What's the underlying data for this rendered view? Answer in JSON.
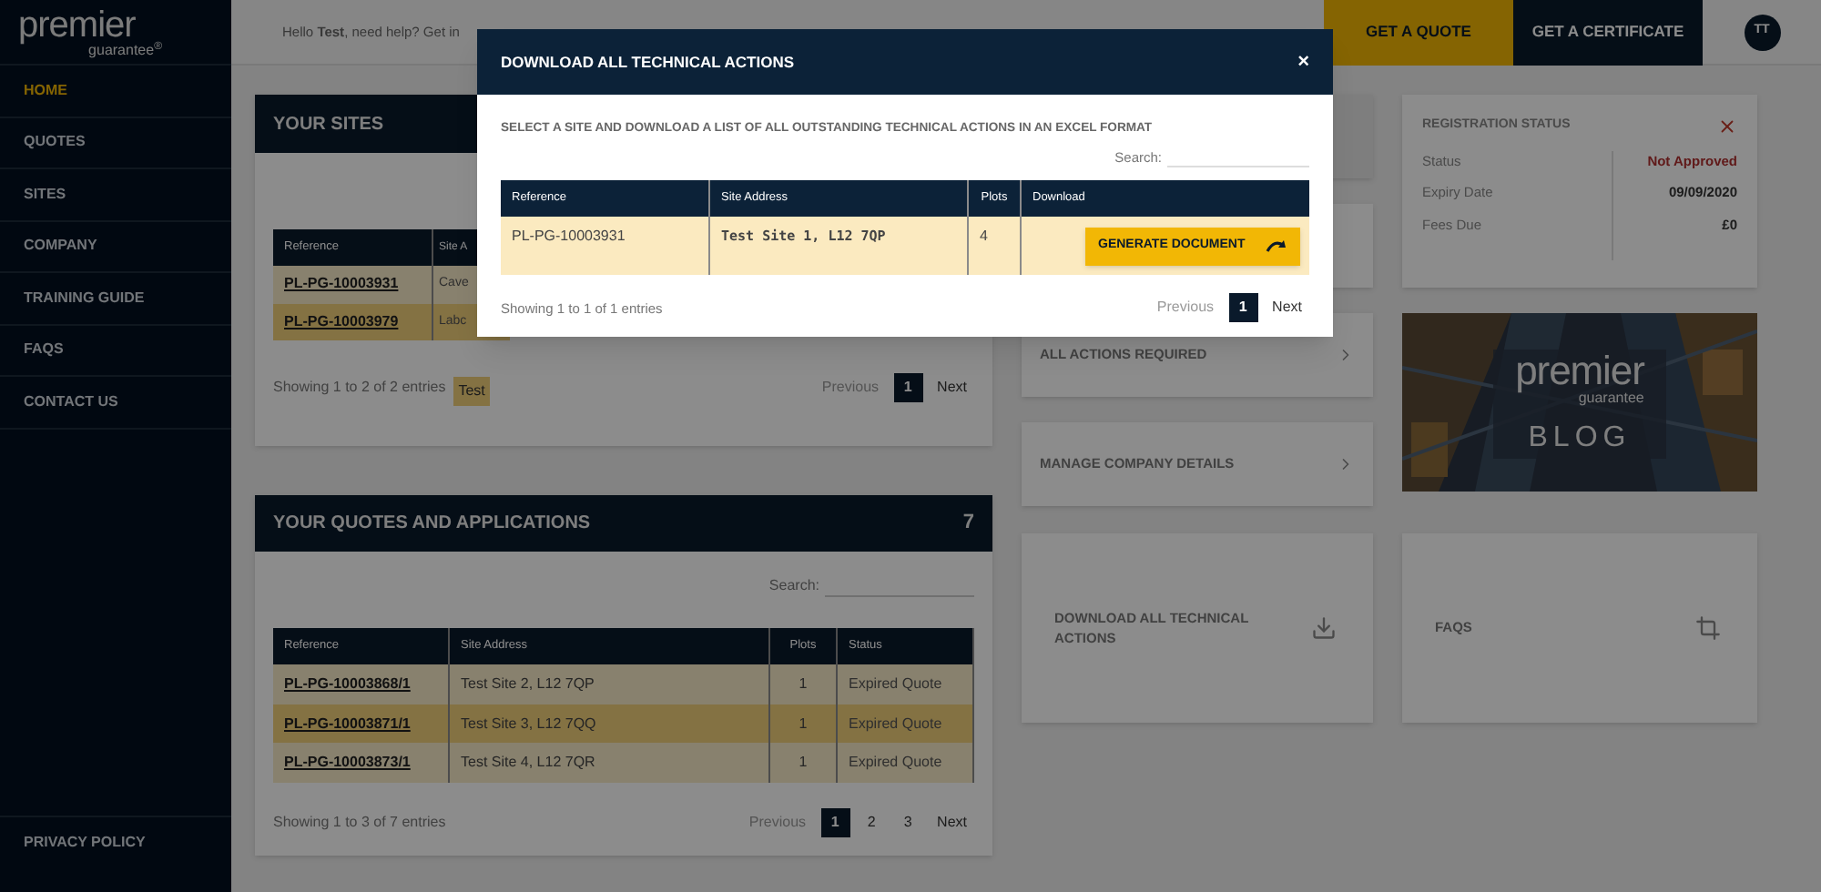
{
  "logo": {
    "word": "premier",
    "sub": "guarantee",
    "mark": "®"
  },
  "sidebar": {
    "items": [
      {
        "label": "HOME",
        "selected": true
      },
      {
        "label": "QUOTES",
        "selected": false
      },
      {
        "label": "SITES",
        "selected": false
      },
      {
        "label": "COMPANY",
        "selected": false
      },
      {
        "label": "TRAINING GUIDE",
        "selected": false
      },
      {
        "label": "FAQS",
        "selected": false
      },
      {
        "label": "CONTACT US",
        "selected": false
      }
    ],
    "footer_items": [
      "PRIVACY POLICY"
    ]
  },
  "topbar": {
    "greeting": "Hello **Test**, need help? Get in",
    "buttons": [
      {
        "label": "GET A QUOTE",
        "kind": "primary"
      },
      {
        "label": "GET A CERTIFICATE",
        "kind": "dark"
      }
    ],
    "avatar": "TT"
  },
  "sites": {
    "title": "YOUR SITES",
    "columns": [
      "Reference",
      "Site A"
    ],
    "rows": [
      [
        "PL-PG-10003931",
        "Cave"
      ],
      [
        "PL-PG-10003979",
        "Labc"
      ]
    ],
    "info": "Showing 1 to 2 of 2 entries",
    "tag": "Test",
    "pagination": {
      "previous": "Previous",
      "pages": [
        {
          "label": "1",
          "selected": true
        }
      ],
      "next": "Next"
    }
  },
  "quotes": {
    "title": "YOUR QUOTES AND APPLICATIONS",
    "count": "7",
    "search_label": "Search:",
    "columns": [
      "Reference",
      "Site Address",
      "Plots",
      "Status"
    ],
    "rows": [
      [
        "PL-PG-10003868/1",
        "Test Site 2, L12 7QP",
        "1",
        "Expired Quote"
      ],
      [
        "PL-PG-10003871/1",
        "Test Site 3, L12 7QQ",
        "1",
        "Expired Quote"
      ],
      [
        "PL-PG-10003873/1",
        "Test Site 4, L12 7QR",
        "1",
        "Expired Quote"
      ]
    ],
    "info": "Showing 1 to 3 of 7 entries",
    "pagination": {
      "previous": "Previous",
      "pages": [
        {
          "label": "1",
          "selected": true
        },
        {
          "label": "2",
          "selected": false
        },
        {
          "label": "3",
          "selected": false
        }
      ],
      "next": "Next"
    }
  },
  "action_cards": [
    {
      "label": "ALL ACTIONS REQUIRED"
    },
    {
      "label": "MANAGE COMPANY DETAILS"
    }
  ],
  "registration": {
    "title": "REGISTRATION STATUS",
    "fields": [
      {
        "label": "Status",
        "value": "Not Approved",
        "alert": true
      },
      {
        "label": "Expiry Date",
        "value": "09/09/2020",
        "alert": false
      },
      {
        "label": "Fees Due",
        "value": "£0",
        "alert": false
      }
    ]
  },
  "blog": {
    "kind": "picture",
    "logo_word": "premier",
    "logo_sub": "guarantee",
    "label": "BLOG"
  },
  "tiles": [
    {
      "label": "DOWNLOAD ALL TECHNICAL ACTIONS"
    },
    {
      "label": "FAQS"
    }
  ],
  "modal": {
    "title": "DOWNLOAD ALL TECHNICAL ACTIONS",
    "close": "×",
    "instruction": "SELECT A SITE AND DOWNLOAD A LIST OF ALL OUTSTANDING TECHNICAL ACTIONS IN AN EXCEL FORMAT",
    "search_label": "Search:",
    "columns": [
      "Reference",
      "Site Address",
      "Plots",
      "Download"
    ],
    "rows": [
      {
        "reference": "PL-PG-10003931",
        "address": "Test Site 1, L12 7QP",
        "plots": "4",
        "button": "GENERATE DOCUMENT"
      }
    ],
    "info": "Showing 1 to 1 of 1 entries",
    "pagination": {
      "previous": "Previous",
      "pages": [
        {
          "label": "1",
          "selected": true
        }
      ],
      "next": "Next"
    }
  }
}
